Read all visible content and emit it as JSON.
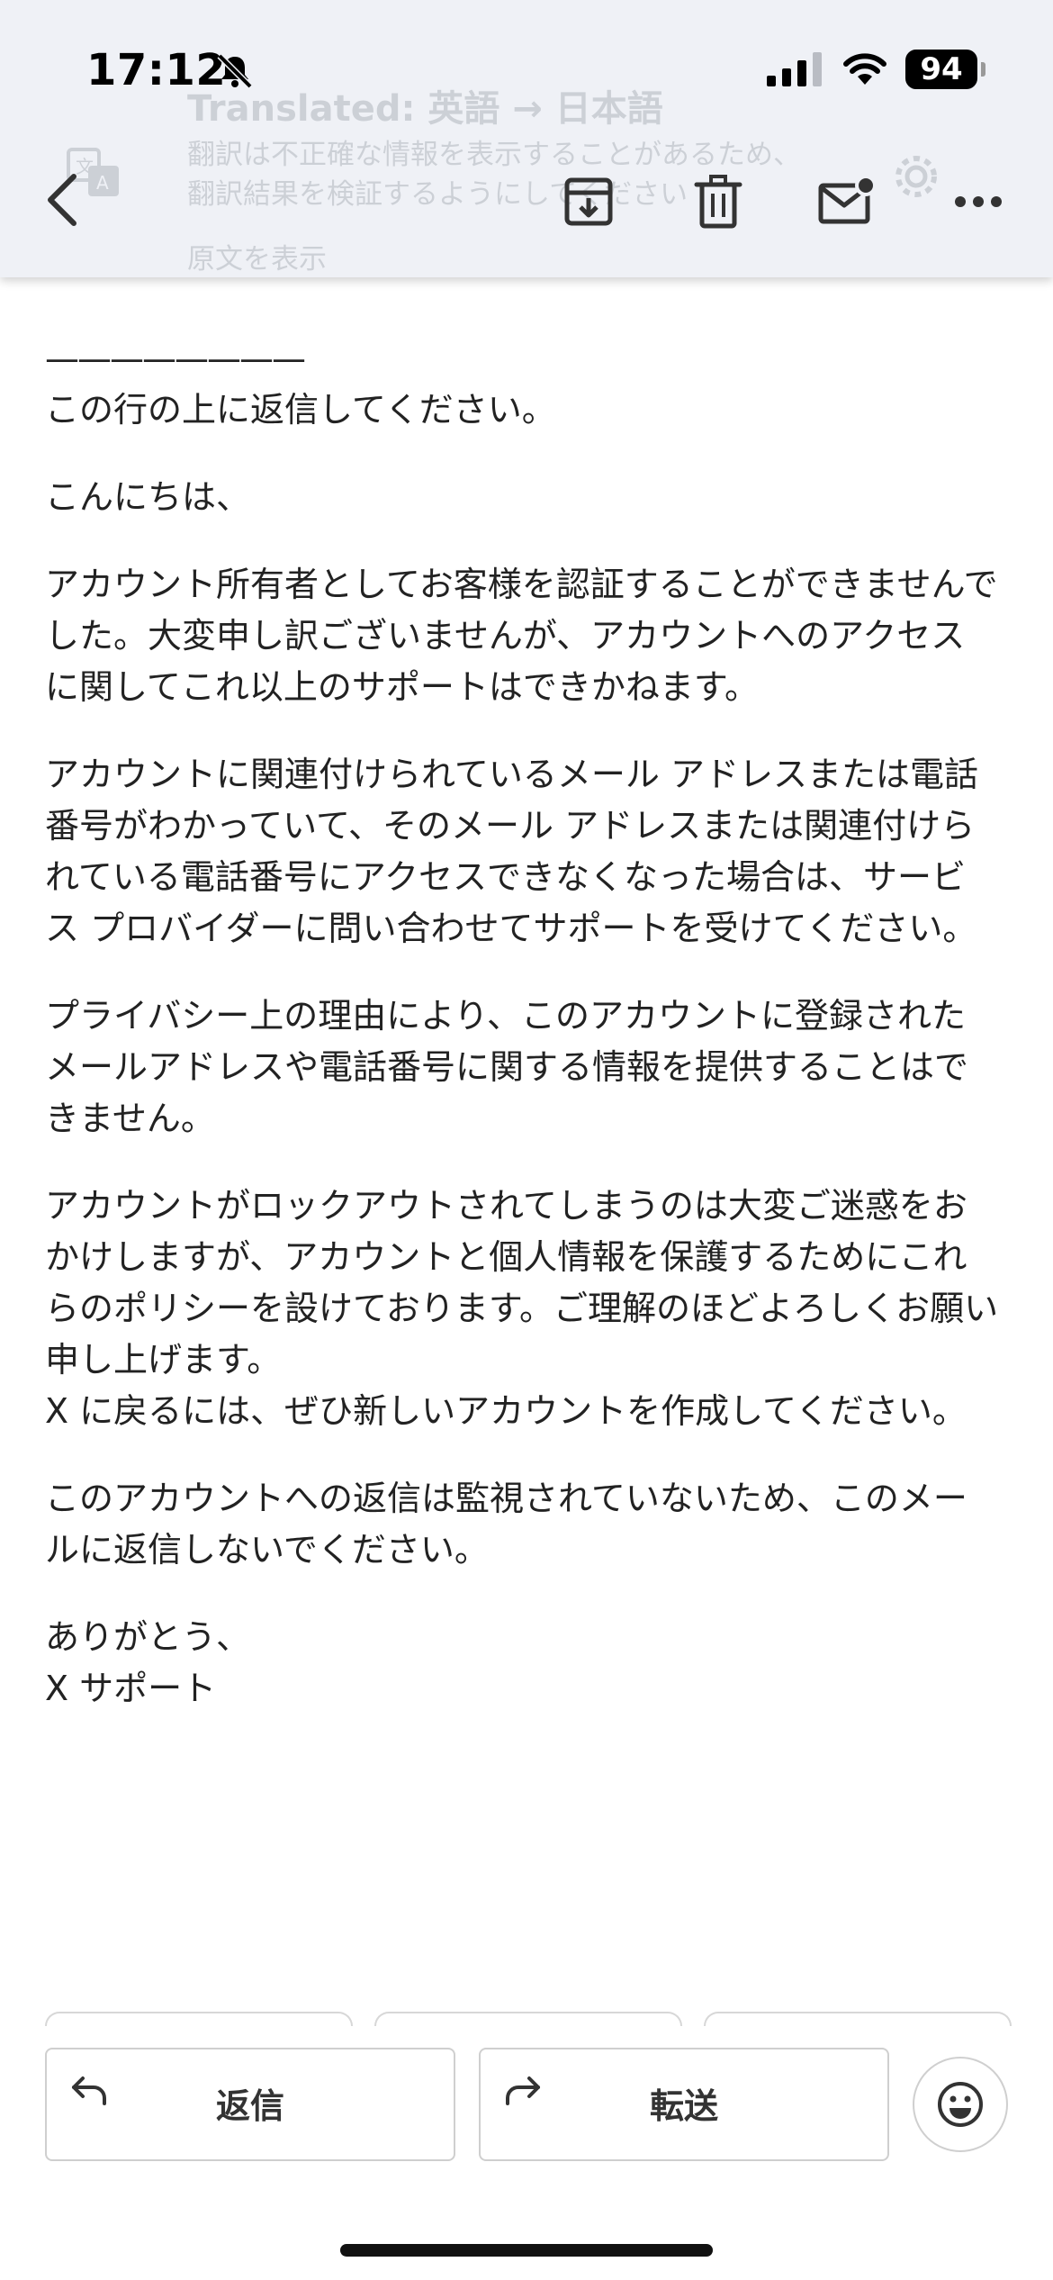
{
  "status_bar": {
    "time": "17:12",
    "battery": "94",
    "icons": [
      "bell-off-icon",
      "cellular-signal-icon",
      "wifi-icon",
      "battery-icon"
    ]
  },
  "translation_banner": {
    "title": "Translated: 英語 → 日本語",
    "description": "翻訳は不正確な情報を表示することがあるため、翻訳結果を検証するようにしてください",
    "show_original": "原文を表示",
    "icons": [
      "translate-icon",
      "gear-icon"
    ]
  },
  "toolbar": {
    "icons": [
      "back-chevron-icon",
      "archive-icon",
      "trash-icon",
      "mark-unread-icon",
      "more-horizontal-icon"
    ]
  },
  "email": {
    "separator": "————————",
    "reply_line": "この行の上に返信してください。",
    "greeting": "こんにちは、",
    "p1": "アカウント所有者としてお客様を認証することができませんでした。大変申し訳ございませんが、アカウントへのアクセスに関してこれ以上のサポートはできかねます。",
    "p2": "アカウントに関連付けられているメール アドレスまたは電話番号がわかっていて、そのメール アドレスまたは関連付けられている電話番号にアクセスできなくなった場合は、サービス プロバイダーに問い合わせてサポートを受けてください。",
    "p3": "プライバシー上の理由により、このアカウントに登録されたメールアドレスや電話番号に関する情報を提供することはできません。",
    "p4": "アカウントがロックアウトされてしまうのは大変ご迷惑をおかけしますが、アカウントと個人情報を保護するためにこれらのポリシーを設けております。ご理解のほどよろしくお願い申し上げます。\nX に戻るには、ぜひ新しいアカウントを作成してください。",
    "p5": "このアカウントへの返信は監視されていないため、このメールに返信しないでください。",
    "signoff": "ありがとう、\nX サポート"
  },
  "actions": {
    "reply_label": "返信",
    "forward_label": "転送",
    "icons": [
      "reply-arrow-icon",
      "forward-arrow-icon",
      "emoji-reaction-icon"
    ]
  }
}
